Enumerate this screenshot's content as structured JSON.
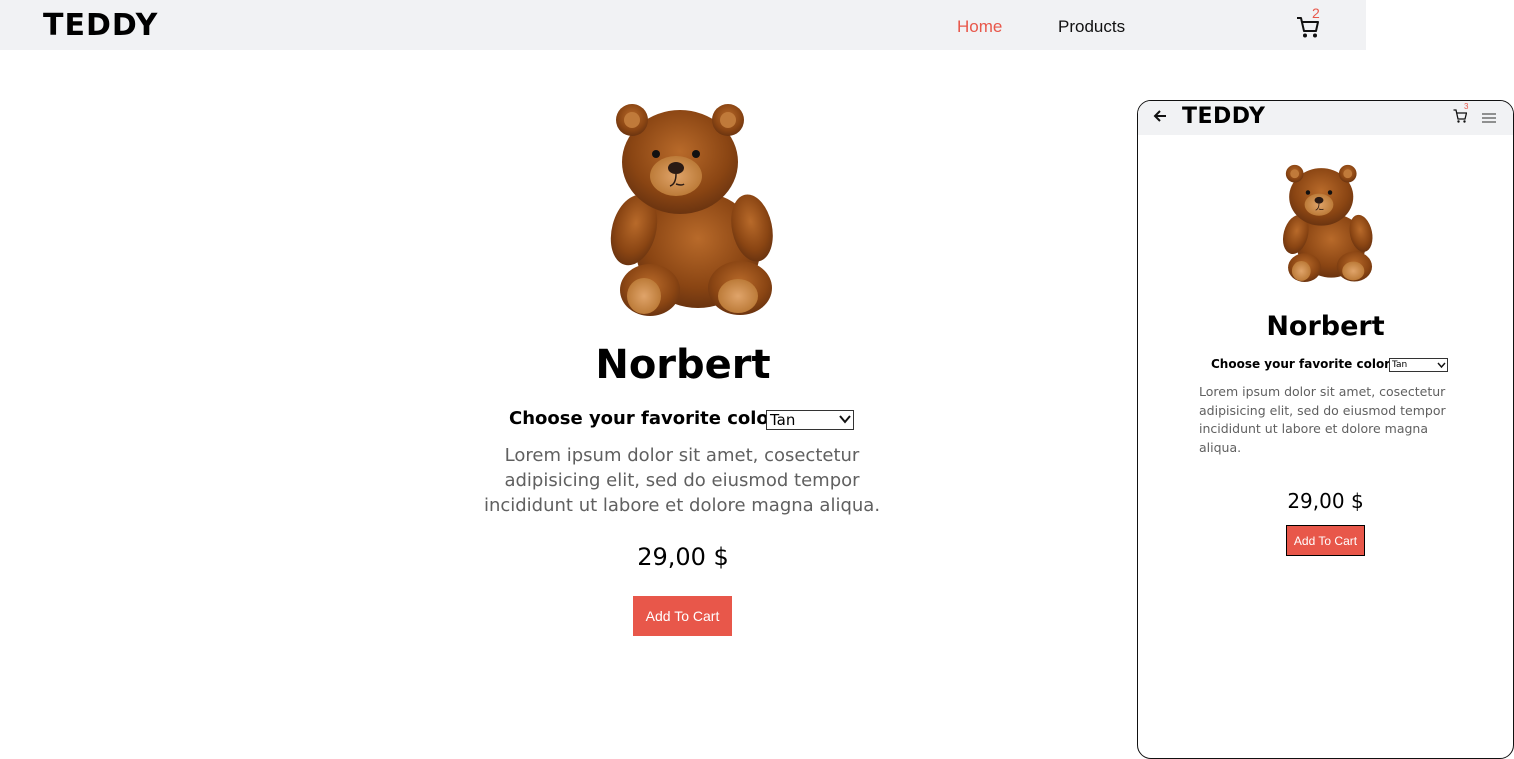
{
  "desktop": {
    "header": {
      "logo": "TEDDY",
      "nav": {
        "home": "Home",
        "products": "Products"
      },
      "cart_count": "2",
      "active_color": "#e8574a"
    },
    "product": {
      "name": "Norbert",
      "color_label": "Choose your favorite color :",
      "color_selected": "Tan",
      "description": "Lorem ipsum dolor sit amet, cosectetur adipisicing elit, sed do eiusmod tempor incididunt ut labore et dolore magna aliqua.",
      "price": "29,00 $",
      "add_to_cart": "Add To Cart",
      "button_color": "#e8574a"
    }
  },
  "mobile": {
    "header": {
      "logo": "TEDDY",
      "cart_count": "3"
    },
    "product": {
      "name": "Norbert",
      "color_label": "Choose your favorite color :",
      "color_selected": "Tan",
      "description": "Lorem ipsum dolor sit amet, cosectetur adipisicing elit, sed do eiusmod tempor incididunt ut labore et dolore magna aliqua.",
      "price": "29,00 $",
      "add_to_cart": "Add To Cart"
    }
  },
  "icons": {
    "cart": "cart-icon",
    "back": "arrow-left-icon",
    "menu": "hamburger-menu-icon",
    "dropdown": "chevron-down-icon"
  }
}
